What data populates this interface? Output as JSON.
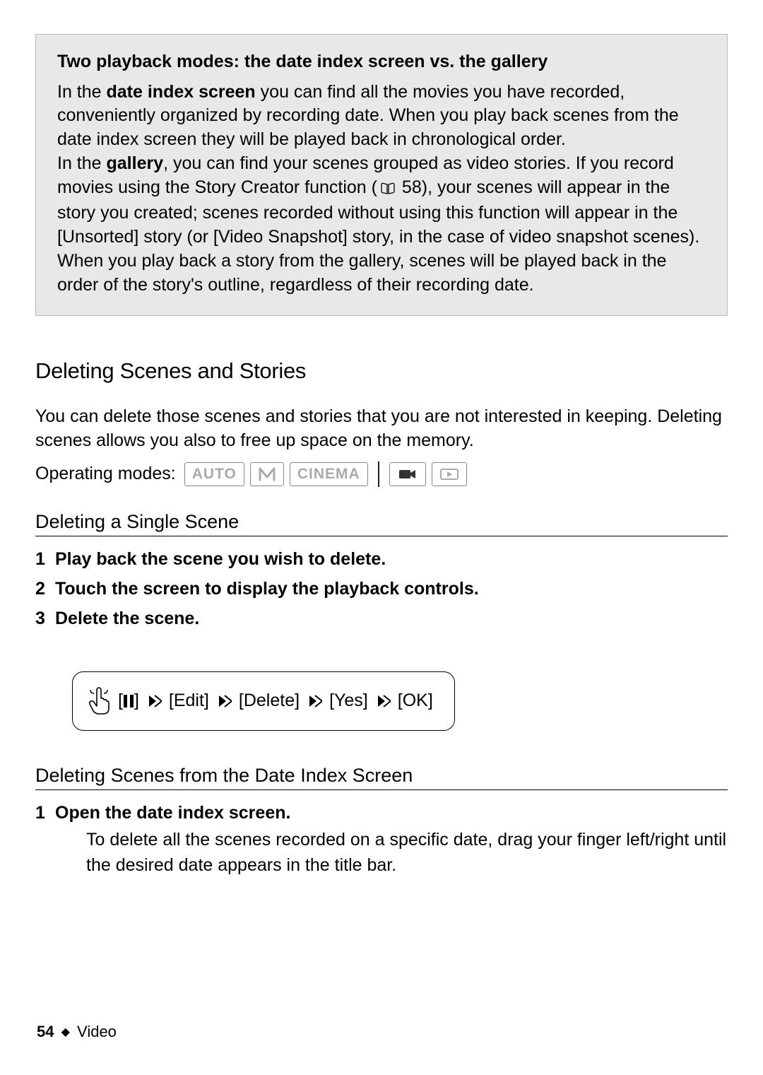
{
  "callout": {
    "title": "Two playback modes: the date index screen vs. the gallery",
    "p1a": "In the ",
    "p1b": "date index screen",
    "p1c": " you can find all the movies you have recorded, conveniently organized by recording date. When you play back scenes from the date index screen they will be played back in chronological order.",
    "p2a": "In the ",
    "p2b": "gallery",
    "p2c": ", you can find your scenes grouped as video stories. If you record movies using the Story Creator function (",
    "p2_xref": " 58",
    "p2d": "), your scenes will appear in the story you created; scenes recorded without using this function will appear in the [Unsorted] story (or [Video Snapshot] story, in the case of video snapshot scenes). When you play back a story from the gallery, scenes will be played back in the order of the story's outline, regardless of their recording date."
  },
  "section": {
    "heading": "Deleting Scenes and Stories",
    "intro": "You can delete those scenes and stories that you are not interested in keeping. Deleting scenes allows you also to free up space on the memory."
  },
  "op_modes": {
    "label": "Operating modes:",
    "items": [
      "AUTO",
      "M",
      "CINEMA"
    ]
  },
  "sub1": {
    "title": "Deleting a Single Scene",
    "steps": [
      {
        "n": "1",
        "title": "Play back the scene you wish to delete."
      },
      {
        "n": "2",
        "title": "Touch the screen to display the playback controls."
      },
      {
        "n": "3",
        "title": "Delete the scene."
      }
    ]
  },
  "sequence": {
    "items": [
      "[",
      "]",
      "[Edit]",
      "[Delete]",
      "[Yes]",
      "[OK]"
    ]
  },
  "sub2": {
    "title": "Deleting Scenes from the Date Index Screen",
    "steps": [
      {
        "n": "1",
        "title": "Open the date index screen.",
        "body": "To delete all the scenes recorded on a specific date, drag your finger left/right until the desired date appears in the title bar."
      }
    ]
  },
  "footer": {
    "page": "54",
    "section": "Video"
  }
}
